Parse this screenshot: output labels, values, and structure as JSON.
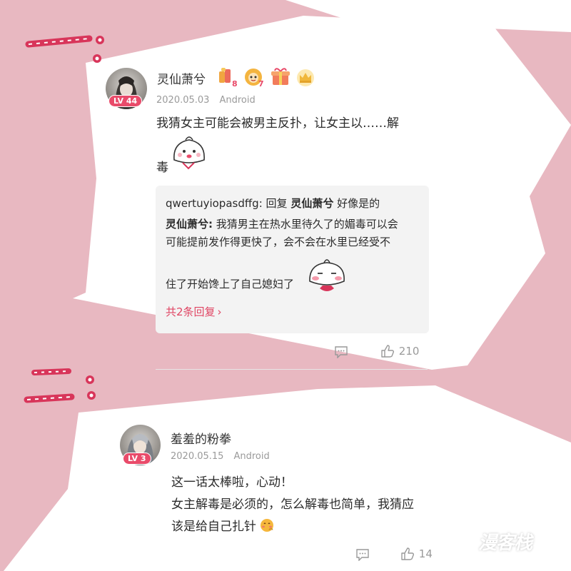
{
  "section1": {
    "username": "灵仙萧兮",
    "level": "LV 44",
    "date": "2020.05.03",
    "platform": "Android",
    "badges": [
      {
        "icon": "fan-badge-icon",
        "count": "8"
      },
      {
        "icon": "monkey-badge-icon",
        "count": "7"
      },
      {
        "icon": "gift-badge-icon",
        "count": ""
      },
      {
        "icon": "crown-badge-icon",
        "count": ""
      }
    ],
    "text_line1": "我猜女主可能会被男主反扑，让女主以……解",
    "text_line2": "毒",
    "reply": {
      "user": "qwertuyiopasdffg:",
      "reply_word": "回复",
      "reply_target": "灵仙萧兮",
      "reply_text": "好像是的",
      "quote_user": "灵仙萧兮:",
      "quote_line1": "我猜男主在热水里待久了的媚毒可以会",
      "quote_line2": "可能提前发作得更快了，会不会在水里已经受不",
      "quote_line3": "住了开始馋上了自己媳妇了",
      "more": "共2条回复"
    },
    "likes": "210"
  },
  "section2": {
    "username": "羞羞的粉拳",
    "level": "LV 3",
    "date": "2020.05.15",
    "platform": "Android",
    "text_line1": "这一话太棒啦，心动！",
    "text_line2": "女主解毒是必须的，怎么解毒也简单，我猜应",
    "text_line3": "该是给自己扎针",
    "likes": "14"
  },
  "watermark": "漫客栈",
  "colors": {
    "background": "#e8b8c1",
    "accent": "#e94b6a",
    "link": "#e04563"
  }
}
